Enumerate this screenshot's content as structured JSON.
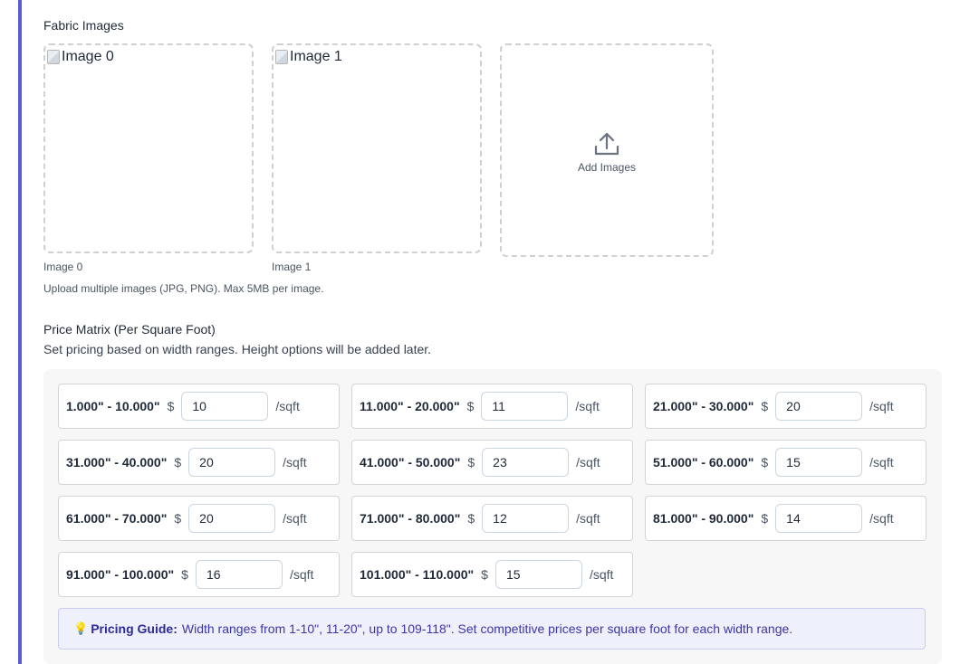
{
  "fabric_images": {
    "title": "Fabric Images",
    "images": [
      {
        "alt": "Image 0",
        "caption": "Image 0"
      },
      {
        "alt": "Image 1",
        "caption": "Image 1"
      }
    ],
    "add_label": "Add Images",
    "help": "Upload multiple images (JPG, PNG). Max 5MB per image."
  },
  "price_matrix": {
    "title": "Price Matrix (Per Square Foot)",
    "subtitle": "Set pricing based on width ranges. Height options will be added later.",
    "currency": "$",
    "unit": "/sqft",
    "rows": [
      {
        "range": "1.000\" - 10.000\"",
        "price": "10"
      },
      {
        "range": "11.000\" - 20.000\"",
        "price": "11"
      },
      {
        "range": "21.000\" - 30.000\"",
        "price": "20"
      },
      {
        "range": "31.000\" - 40.000\"",
        "price": "20"
      },
      {
        "range": "41.000\" - 50.000\"",
        "price": "23"
      },
      {
        "range": "51.000\" - 60.000\"",
        "price": "15"
      },
      {
        "range": "61.000\" - 70.000\"",
        "price": "20"
      },
      {
        "range": "71.000\" - 80.000\"",
        "price": "12"
      },
      {
        "range": "81.000\" - 90.000\"",
        "price": "14"
      },
      {
        "range": "91.000\" - 100.000\"",
        "price": "16"
      },
      {
        "range": "101.000\" - 110.000\"",
        "price": "15"
      }
    ],
    "guide": {
      "icon": "lightbulb-icon",
      "label": "Pricing Guide:",
      "text": "Width ranges from 1-10\", 11-20\", up to 109-118\". Set competitive prices per square foot for each width range."
    }
  },
  "colors": {
    "accent_bar": "#5b5bd6",
    "guide_bg": "#eef0fb",
    "guide_text": "#3b36a8"
  }
}
